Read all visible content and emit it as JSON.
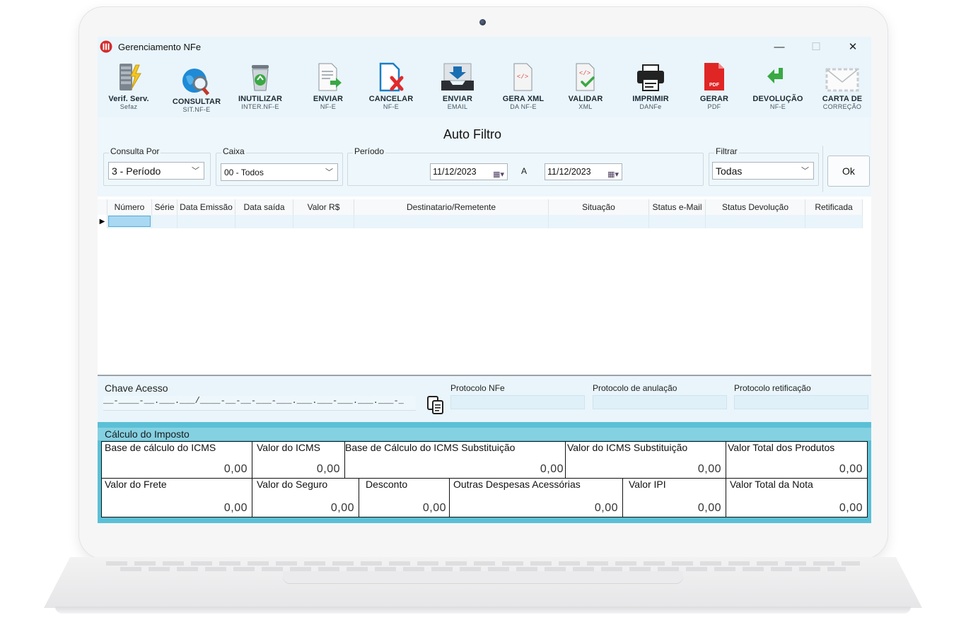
{
  "window": {
    "title": "Gerenciamento NFe"
  },
  "window_controls": {
    "minimize": "—",
    "maximize": "☐",
    "close": "✕"
  },
  "toolbar": [
    {
      "id": "verif",
      "label1": "Verif. Serv.",
      "label2": "Sefaz",
      "icon": "server-lightning-icon"
    },
    {
      "id": "consultar",
      "label1": "CONSULTAR",
      "label2": "SIT.NF-E",
      "icon": "globe-search-icon"
    },
    {
      "id": "inutilizar",
      "label1": "INUTILIZAR",
      "label2": "INTER.NF-E",
      "icon": "recycle-bin-icon"
    },
    {
      "id": "enviar",
      "label1": "ENVIAR",
      "label2": "NF-E",
      "icon": "document-send-icon"
    },
    {
      "id": "cancelar",
      "label1": "CANCELAR",
      "label2": "NF-E",
      "icon": "document-cancel-icon"
    },
    {
      "id": "enviar-email",
      "label1": "ENVIAR",
      "label2": "EMAIL",
      "icon": "inbox-download-icon"
    },
    {
      "id": "gera-xml",
      "label1": "GERA XML",
      "label2": "DA NF-E",
      "icon": "xml-document-icon"
    },
    {
      "id": "validar",
      "label1": "VALIDAR",
      "label2": "XML",
      "icon": "xml-check-icon"
    },
    {
      "id": "imprimir",
      "label1": "IMPRIMIR",
      "label2": "DANFe",
      "icon": "printer-icon"
    },
    {
      "id": "gerar-pdf",
      "label1": "GERAR",
      "label2": "PDF",
      "icon": "pdf-icon"
    },
    {
      "id": "devolucao",
      "label1": "DEVOLUÇÃO",
      "label2": "NF-E",
      "icon": "return-arrow-icon"
    },
    {
      "id": "carta",
      "label1": "CARTA DE",
      "label2": "CORREÇÃO",
      "icon": "envelope-icon"
    }
  ],
  "filter": {
    "title": "Auto Filtro",
    "consulta_por": {
      "label": "Consulta Por",
      "value": "3 - Período"
    },
    "caixa": {
      "label": "Caixa",
      "value": "00 - Todos"
    },
    "periodo": {
      "label": "Período",
      "from": "11/12/2023",
      "separator": "A",
      "to": "11/12/2023"
    },
    "filtrar": {
      "label": "Filtrar",
      "value": "Todas"
    },
    "ok_label": "Ok"
  },
  "grid": {
    "columns": [
      "Número",
      "Série",
      "Data Emissão",
      "Data saída",
      "Valor R$",
      "Destinatario/Remetente",
      "Situação",
      "Status e-Mail",
      "Status Devolução",
      "Retificada"
    ]
  },
  "chave": {
    "label": "Chave Acesso",
    "mask": "__-____-__.___.___/____-__-__-___-___.___.___-___.___.___-_",
    "protocolo_nfe": "Protocolo NFe",
    "protocolo_anulacao": "Protocolo de anulação",
    "protocolo_retificacao": "Protocolo retificação"
  },
  "imposto": {
    "title": "Cálculo do Imposto",
    "row1": [
      {
        "label": "Base de cálculo do ICMS",
        "value": "0,00"
      },
      {
        "label": "Valor do ICMS",
        "value": "0,00"
      },
      {
        "label": "Base de Cálculo do ICMS Substituição",
        "value": "0,00"
      },
      {
        "label": "Valor do ICMS Substituição",
        "value": "0,00"
      },
      {
        "label": "Valor Total dos Produtos",
        "value": "0,00"
      }
    ],
    "row2": [
      {
        "label": "Valor do Frete",
        "value": "0,00"
      },
      {
        "label": "Valor do Seguro",
        "value": "0,00"
      },
      {
        "label": "Desconto",
        "value": "0,00"
      },
      {
        "label": "Outras Despesas Acessórias",
        "value": "0,00"
      },
      {
        "label": "Valor IPI",
        "value": "0,00"
      },
      {
        "label": "Valor Total da Nota",
        "value": "0,00"
      }
    ]
  }
}
